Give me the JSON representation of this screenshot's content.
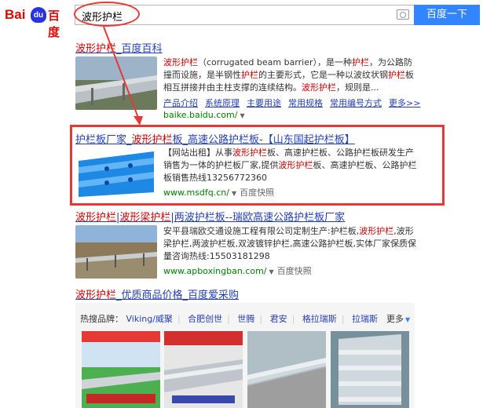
{
  "header": {
    "logo_latin": "Bai",
    "logo_paw": "du",
    "logo_cn": "百度",
    "query": "波形护栏",
    "search_button": "百度一下"
  },
  "results": [
    {
      "title_parts": [
        "波形护栏",
        "_百度百科"
      ],
      "body_parts": [
        "波形护栏",
        "（corrugated beam barrier），是一种",
        "护栏",
        "，为公路防撞而设施，是半钢性",
        "护栏",
        "的主要形式，它是一种以波纹状钢",
        "护栏",
        "板相互拼接并由主柱支撑的连续结构。",
        "波形护栏",
        "，规则是..."
      ],
      "links": [
        "产品介绍",
        "系统原理",
        "主要用途",
        "常用规格",
        "常用编号方式",
        "更多>>"
      ],
      "url": "baike.baidu.com/"
    },
    {
      "title_parts": [
        "护栏板厂家",
        "_",
        "波形护栏",
        "板_高速公路护栏板-【山东国起护栏板】"
      ],
      "body_parts": [
        "【网站出租】从事",
        "波形护栏",
        "板、高速护栏板、公路护栏板研发生产销售为一体的护栏板厂家,提供",
        "波形护栏",
        "板、高速护栏板、公路护栏板销售热线13256772360"
      ],
      "url": "www.msdfq.cn/",
      "snapshot": "百度快照"
    },
    {
      "title_parts": [
        "波形护栏",
        "|",
        "波形梁护栏",
        "|两波护栏板--瑞欧高速公路护栏板厂家"
      ],
      "body_parts": [
        "安平县瑞欧交通设施工程有限公司定制生产:护栏板,",
        "波形护栏",
        ",波形梁护栏,两波护栏板,双波镀锌护栏,高速公路护栏板,实体厂家保质保量咨询热线:15503181298"
      ],
      "url": "www.apboxingban.com/",
      "snapshot": "百度快照"
    },
    {
      "title_parts": [
        "波形护栏",
        "_优质商品价格_百度爱采购"
      ],
      "hot_label": "热搜品牌：",
      "brands": [
        "Viking/威聚",
        "合肥创世",
        "世腾",
        "君安",
        "格拉瑞斯",
        "拉瑞斯"
      ],
      "more": "更多"
    }
  ],
  "colors": {
    "link": "#2440b3",
    "highlight": "#cc0000",
    "url": "#008000",
    "annotation": "#e53935",
    "button": "#3385ff"
  },
  "icons": [
    "camera-icon",
    "paw-logo-icon",
    "dropdown-triangle-icon"
  ]
}
